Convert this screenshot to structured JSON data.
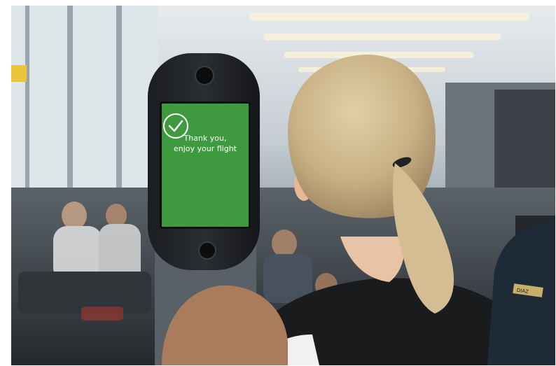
{
  "kiosk": {
    "message": "Thank you,\nenjoy your flight",
    "status_icon": "checkmark-circle-icon",
    "screen_color": "#3f9a3f"
  },
  "badge": {
    "text": "DIAZ"
  }
}
